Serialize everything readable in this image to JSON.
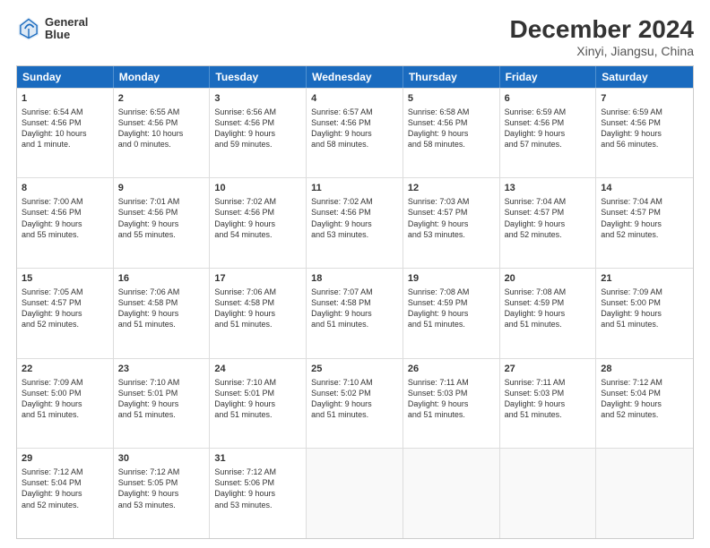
{
  "header": {
    "logo_line1": "General",
    "logo_line2": "Blue",
    "title": "December 2024",
    "subtitle": "Xinyi, Jiangsu, China"
  },
  "calendar": {
    "day_headers": [
      "Sunday",
      "Monday",
      "Tuesday",
      "Wednesday",
      "Thursday",
      "Friday",
      "Saturday"
    ],
    "weeks": [
      [
        {
          "day": "1",
          "lines": [
            "Sunrise: 6:54 AM",
            "Sunset: 4:56 PM",
            "Daylight: 10 hours",
            "and 1 minute."
          ]
        },
        {
          "day": "2",
          "lines": [
            "Sunrise: 6:55 AM",
            "Sunset: 4:56 PM",
            "Daylight: 10 hours",
            "and 0 minutes."
          ]
        },
        {
          "day": "3",
          "lines": [
            "Sunrise: 6:56 AM",
            "Sunset: 4:56 PM",
            "Daylight: 9 hours",
            "and 59 minutes."
          ]
        },
        {
          "day": "4",
          "lines": [
            "Sunrise: 6:57 AM",
            "Sunset: 4:56 PM",
            "Daylight: 9 hours",
            "and 58 minutes."
          ]
        },
        {
          "day": "5",
          "lines": [
            "Sunrise: 6:58 AM",
            "Sunset: 4:56 PM",
            "Daylight: 9 hours",
            "and 58 minutes."
          ]
        },
        {
          "day": "6",
          "lines": [
            "Sunrise: 6:59 AM",
            "Sunset: 4:56 PM",
            "Daylight: 9 hours",
            "and 57 minutes."
          ]
        },
        {
          "day": "7",
          "lines": [
            "Sunrise: 6:59 AM",
            "Sunset: 4:56 PM",
            "Daylight: 9 hours",
            "and 56 minutes."
          ]
        }
      ],
      [
        {
          "day": "8",
          "lines": [
            "Sunrise: 7:00 AM",
            "Sunset: 4:56 PM",
            "Daylight: 9 hours",
            "and 55 minutes."
          ]
        },
        {
          "day": "9",
          "lines": [
            "Sunrise: 7:01 AM",
            "Sunset: 4:56 PM",
            "Daylight: 9 hours",
            "and 55 minutes."
          ]
        },
        {
          "day": "10",
          "lines": [
            "Sunrise: 7:02 AM",
            "Sunset: 4:56 PM",
            "Daylight: 9 hours",
            "and 54 minutes."
          ]
        },
        {
          "day": "11",
          "lines": [
            "Sunrise: 7:02 AM",
            "Sunset: 4:56 PM",
            "Daylight: 9 hours",
            "and 53 minutes."
          ]
        },
        {
          "day": "12",
          "lines": [
            "Sunrise: 7:03 AM",
            "Sunset: 4:57 PM",
            "Daylight: 9 hours",
            "and 53 minutes."
          ]
        },
        {
          "day": "13",
          "lines": [
            "Sunrise: 7:04 AM",
            "Sunset: 4:57 PM",
            "Daylight: 9 hours",
            "and 52 minutes."
          ]
        },
        {
          "day": "14",
          "lines": [
            "Sunrise: 7:04 AM",
            "Sunset: 4:57 PM",
            "Daylight: 9 hours",
            "and 52 minutes."
          ]
        }
      ],
      [
        {
          "day": "15",
          "lines": [
            "Sunrise: 7:05 AM",
            "Sunset: 4:57 PM",
            "Daylight: 9 hours",
            "and 52 minutes."
          ]
        },
        {
          "day": "16",
          "lines": [
            "Sunrise: 7:06 AM",
            "Sunset: 4:58 PM",
            "Daylight: 9 hours",
            "and 51 minutes."
          ]
        },
        {
          "day": "17",
          "lines": [
            "Sunrise: 7:06 AM",
            "Sunset: 4:58 PM",
            "Daylight: 9 hours",
            "and 51 minutes."
          ]
        },
        {
          "day": "18",
          "lines": [
            "Sunrise: 7:07 AM",
            "Sunset: 4:58 PM",
            "Daylight: 9 hours",
            "and 51 minutes."
          ]
        },
        {
          "day": "19",
          "lines": [
            "Sunrise: 7:08 AM",
            "Sunset: 4:59 PM",
            "Daylight: 9 hours",
            "and 51 minutes."
          ]
        },
        {
          "day": "20",
          "lines": [
            "Sunrise: 7:08 AM",
            "Sunset: 4:59 PM",
            "Daylight: 9 hours",
            "and 51 minutes."
          ]
        },
        {
          "day": "21",
          "lines": [
            "Sunrise: 7:09 AM",
            "Sunset: 5:00 PM",
            "Daylight: 9 hours",
            "and 51 minutes."
          ]
        }
      ],
      [
        {
          "day": "22",
          "lines": [
            "Sunrise: 7:09 AM",
            "Sunset: 5:00 PM",
            "Daylight: 9 hours",
            "and 51 minutes."
          ]
        },
        {
          "day": "23",
          "lines": [
            "Sunrise: 7:10 AM",
            "Sunset: 5:01 PM",
            "Daylight: 9 hours",
            "and 51 minutes."
          ]
        },
        {
          "day": "24",
          "lines": [
            "Sunrise: 7:10 AM",
            "Sunset: 5:01 PM",
            "Daylight: 9 hours",
            "and 51 minutes."
          ]
        },
        {
          "day": "25",
          "lines": [
            "Sunrise: 7:10 AM",
            "Sunset: 5:02 PM",
            "Daylight: 9 hours",
            "and 51 minutes."
          ]
        },
        {
          "day": "26",
          "lines": [
            "Sunrise: 7:11 AM",
            "Sunset: 5:03 PM",
            "Daylight: 9 hours",
            "and 51 minutes."
          ]
        },
        {
          "day": "27",
          "lines": [
            "Sunrise: 7:11 AM",
            "Sunset: 5:03 PM",
            "Daylight: 9 hours",
            "and 51 minutes."
          ]
        },
        {
          "day": "28",
          "lines": [
            "Sunrise: 7:12 AM",
            "Sunset: 5:04 PM",
            "Daylight: 9 hours",
            "and 52 minutes."
          ]
        }
      ],
      [
        {
          "day": "29",
          "lines": [
            "Sunrise: 7:12 AM",
            "Sunset: 5:04 PM",
            "Daylight: 9 hours",
            "and 52 minutes."
          ]
        },
        {
          "day": "30",
          "lines": [
            "Sunrise: 7:12 AM",
            "Sunset: 5:05 PM",
            "Daylight: 9 hours",
            "and 53 minutes."
          ]
        },
        {
          "day": "31",
          "lines": [
            "Sunrise: 7:12 AM",
            "Sunset: 5:06 PM",
            "Daylight: 9 hours",
            "and 53 minutes."
          ]
        },
        {
          "day": "",
          "lines": []
        },
        {
          "day": "",
          "lines": []
        },
        {
          "day": "",
          "lines": []
        },
        {
          "day": "",
          "lines": []
        }
      ]
    ]
  }
}
